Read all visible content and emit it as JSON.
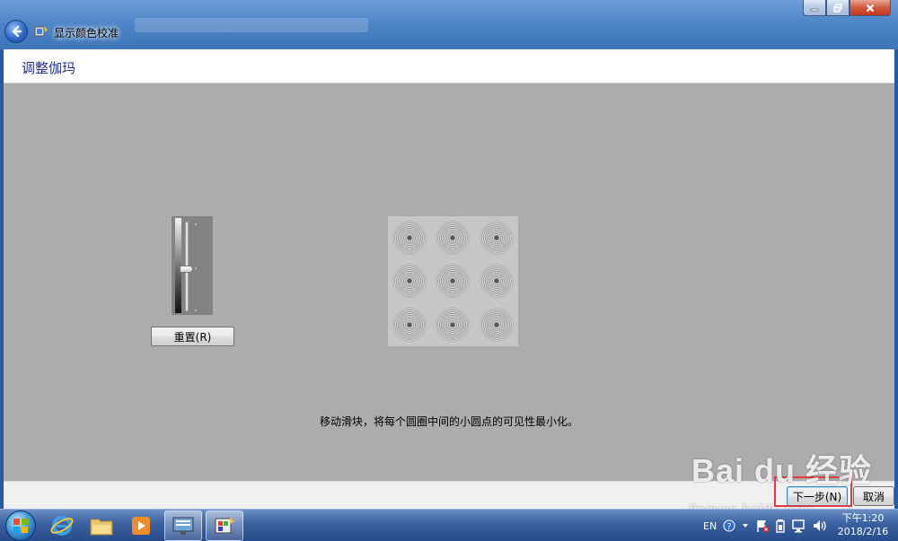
{
  "window": {
    "title": "显示颜色校准"
  },
  "page": {
    "heading": "调整伽玛",
    "instruction": "移动滑块，将每个圆圈中间的小圆点的可见性最小化。",
    "reset_label": "重置(R)"
  },
  "gamma_slider": {
    "value_fraction": 0.53
  },
  "footer": {
    "next_label": "下一步(N)",
    "cancel_label": "取消"
  },
  "watermark": {
    "brand": "Bai du 经验",
    "url": "jingyan.baidu.com"
  },
  "taskbar": {
    "apps": [
      "ie-icon",
      "explorer-icon",
      "media-player-icon",
      "display-settings-icon",
      "color-calibration-icon"
    ],
    "language": "EN",
    "clock_time": "下午1:20",
    "clock_date": "2018/2/16"
  },
  "colors": {
    "content_bg": "#acabad",
    "heading_color": "#1e3287",
    "highlight_border": "#e23b3b"
  }
}
